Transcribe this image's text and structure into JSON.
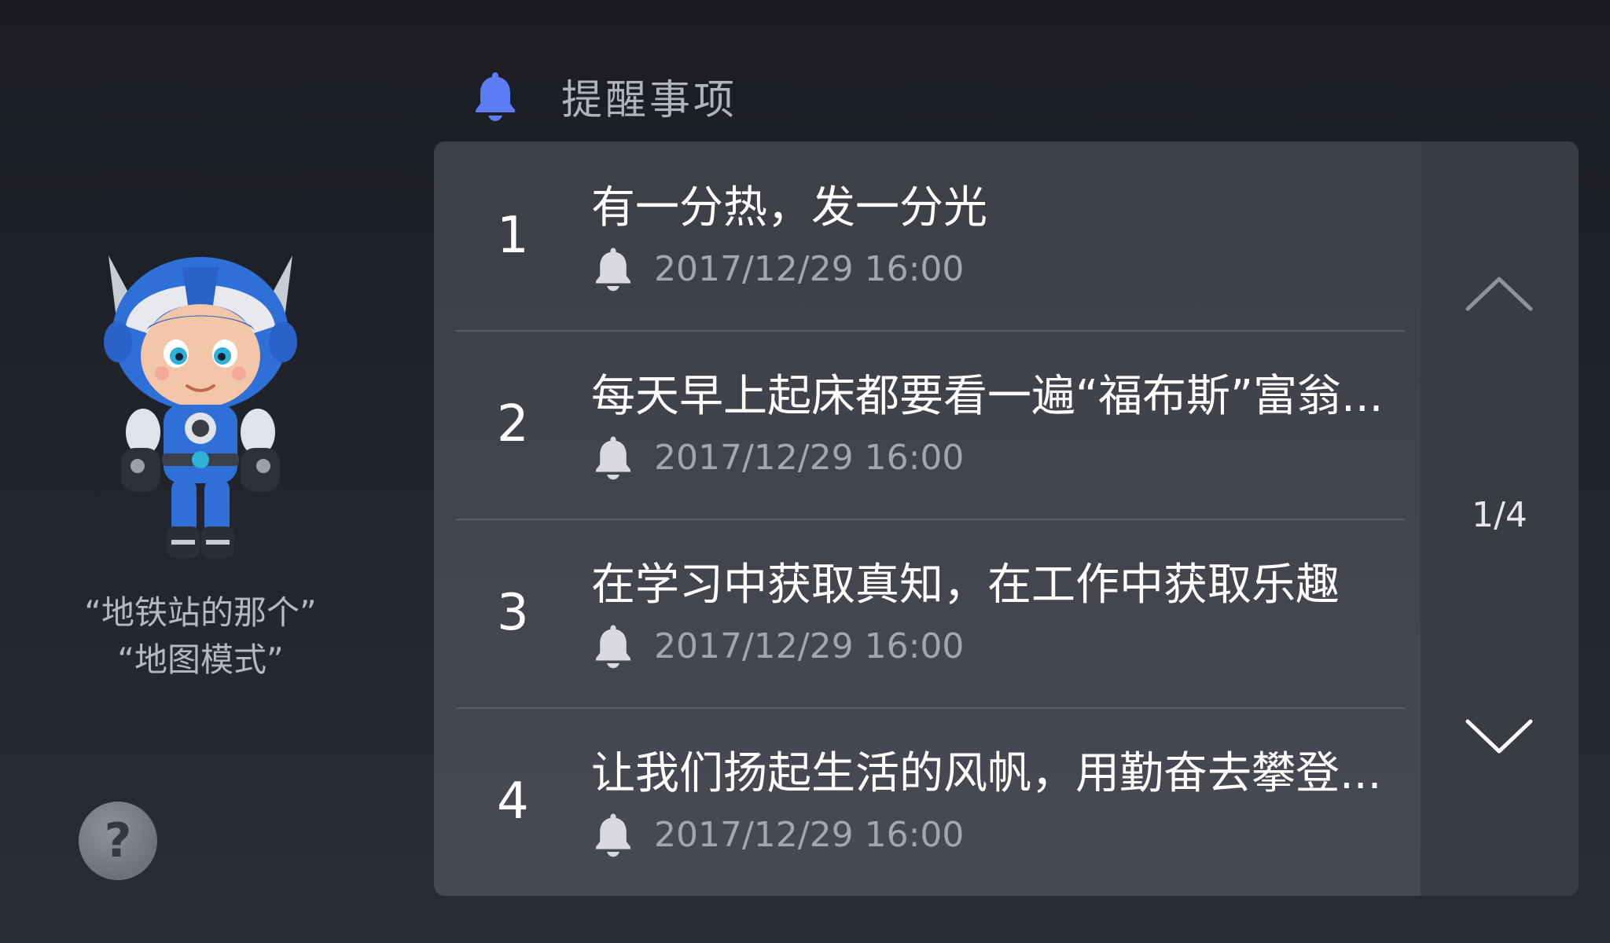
{
  "header": {
    "title": "提醒事项",
    "icon": "bell-icon",
    "icon_color": "#5b7cf2"
  },
  "assistant": {
    "hint_line_1": "“地铁站的那个”",
    "hint_line_2": "“地图模式”",
    "help_label": "?"
  },
  "reminders": [
    {
      "index": "1",
      "text": "有一分热，发一分光",
      "time": "2017/12/29 16:00"
    },
    {
      "index": "2",
      "text": "每天早上起床都要看一遍“福布斯”富翁...",
      "time": "2017/12/29 16:00"
    },
    {
      "index": "3",
      "text": "在学习中获取真知，在工作中获取乐趣",
      "time": "2017/12/29 16:00"
    },
    {
      "index": "4",
      "text": "让我们扬起生活的风帆，用勤奋去攀登...",
      "time": "2017/12/29 16:00"
    }
  ],
  "pager": {
    "page_indicator": "1/4",
    "up_icon": "chevron-up-icon",
    "down_icon": "chevron-down-icon"
  },
  "colors": {
    "accent": "#5b7cf2",
    "panel": "#43454e",
    "pager_column": "#3a3c43",
    "secondary_text": "#a3a6af"
  }
}
